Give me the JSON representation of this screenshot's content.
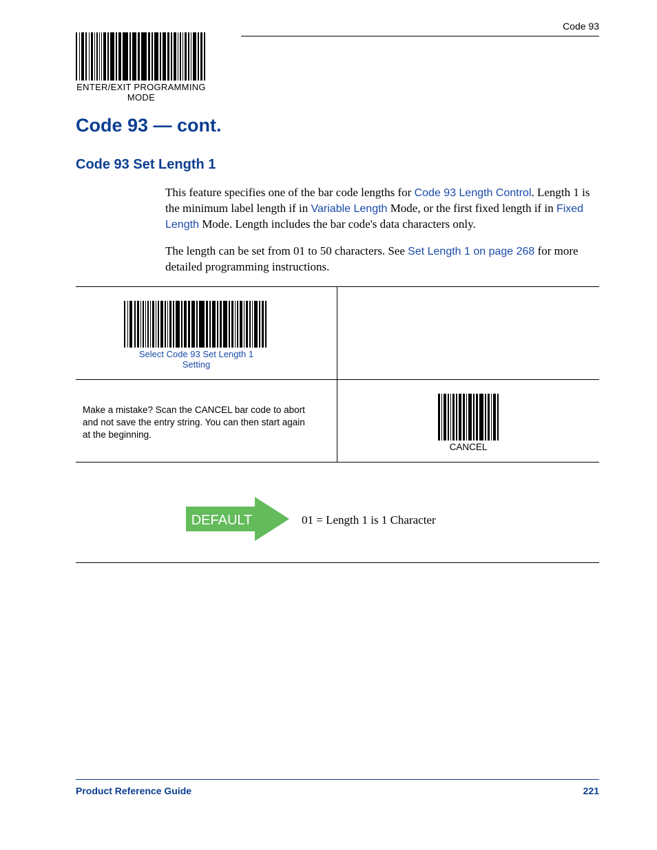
{
  "header": {
    "running_head": "Code 93",
    "enter_exit_label": "ENTER/EXIT PROGRAMMING MODE"
  },
  "headings": {
    "h1": "Code 93 — cont.",
    "h2": "Code 93 Set Length 1"
  },
  "paragraphs": {
    "p1_a": "This feature specifies one of the bar code lengths for ",
    "p1_link1": "Code 93 Length Control",
    "p1_b": ". Length 1 is the minimum label length if in ",
    "p1_link2": "Variable Length",
    "p1_c": " Mode, or the first fixed length if in ",
    "p1_link3": "Fixed Length",
    "p1_d": " Mode. Length includes the bar code's data characters only.",
    "p2_a": "The length can be set from 01 to 50 characters. See ",
    "p2_link1": "Set Length 1 on page 268",
    "p2_b": " for more detailed programming instructions."
  },
  "table": {
    "select_caption": "Select Code 93 Set Length 1 Setting",
    "mistake_text": "Make a mistake? Scan the CANCEL bar code to abort and not save the entry string. You can then start again at the beginning.",
    "cancel_label": "CANCEL"
  },
  "default": {
    "badge": "DEFAULT",
    "value": "01 = Length 1 is 1 Character"
  },
  "footer": {
    "left": "Product Reference Guide",
    "right": "221"
  }
}
